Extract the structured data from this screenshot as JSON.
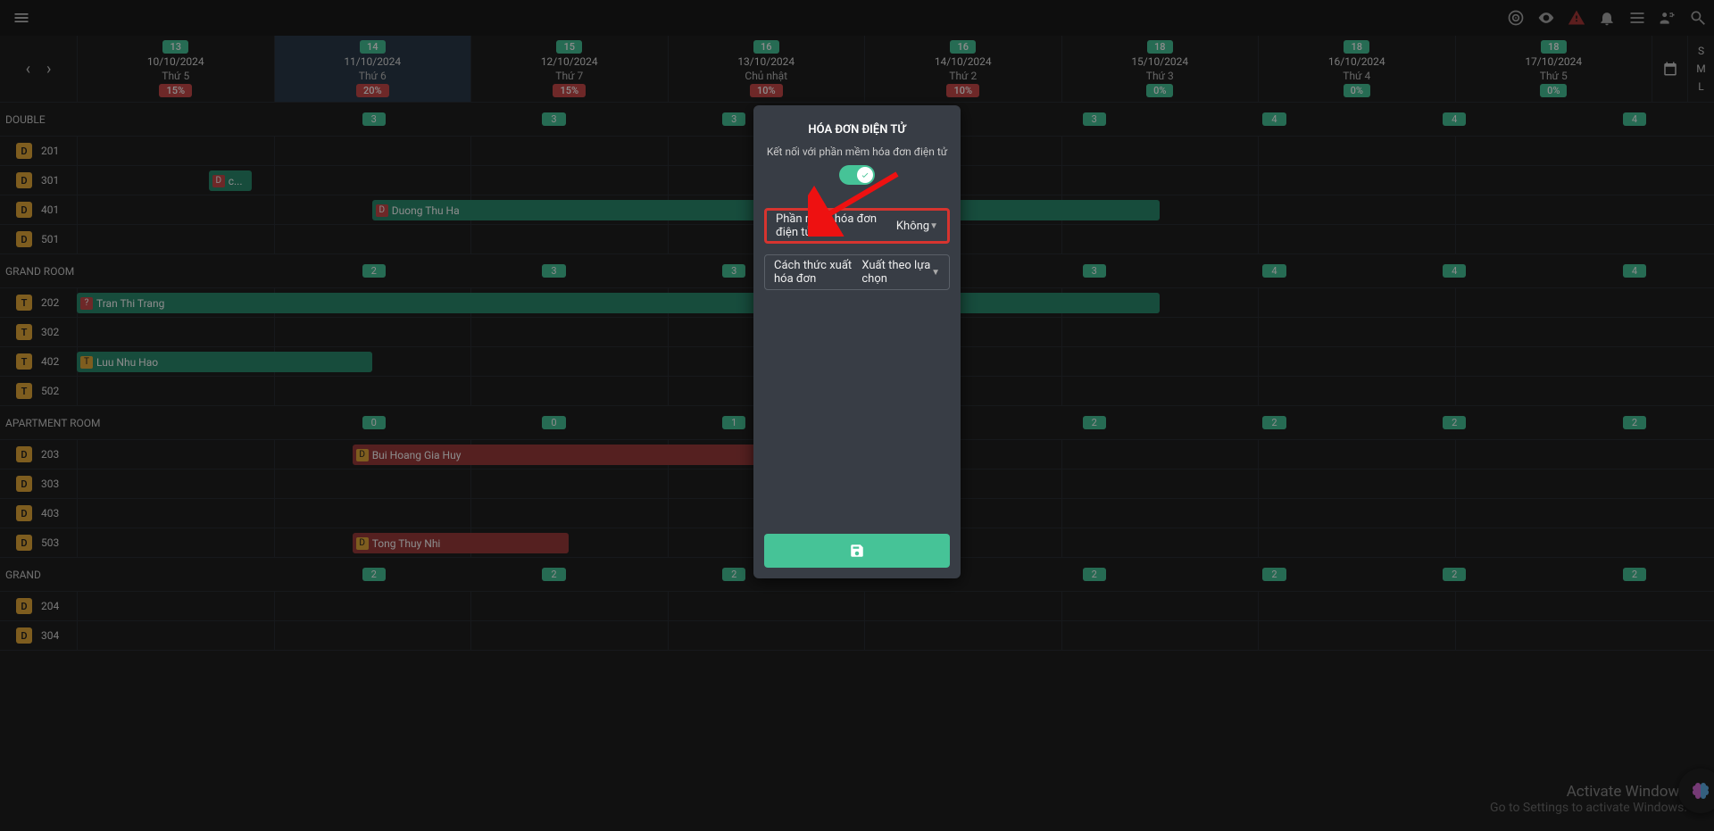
{
  "colors": {
    "teal": "#46c397",
    "red": "#c94a4a",
    "amber": "#e6a93a"
  },
  "sizes": [
    "S",
    "M",
    "L"
  ],
  "days": [
    {
      "badge": "13",
      "date": "10/10/2024",
      "dow": "Thứ 5",
      "pct": "15%",
      "pctClass": "red",
      "selected": false
    },
    {
      "badge": "14",
      "date": "11/10/2024",
      "dow": "Thứ 6",
      "pct": "20%",
      "pctClass": "red",
      "selected": true
    },
    {
      "badge": "15",
      "date": "12/10/2024",
      "dow": "Thứ 7",
      "pct": "15%",
      "pctClass": "red",
      "selected": false
    },
    {
      "badge": "16",
      "date": "13/10/2024",
      "dow": "Chủ nhật",
      "pct": "10%",
      "pctClass": "red",
      "selected": false
    },
    {
      "badge": "16",
      "date": "14/10/2024",
      "dow": "Thứ 2",
      "pct": "10%",
      "pctClass": "red",
      "selected": false
    },
    {
      "badge": "18",
      "date": "15/10/2024",
      "dow": "Thứ 3",
      "pct": "0%",
      "pctClass": "teal",
      "selected": false
    },
    {
      "badge": "18",
      "date": "16/10/2024",
      "dow": "Thứ 4",
      "pct": "0%",
      "pctClass": "teal",
      "selected": false
    },
    {
      "badge": "18",
      "date": "17/10/2024",
      "dow": "Thứ 5",
      "pct": "0%",
      "pctClass": "teal",
      "selected": false
    }
  ],
  "sections": [
    {
      "name": "DOUBLE",
      "counts": [
        "3",
        "3",
        "3",
        "",
        "3",
        "4",
        "4",
        "4"
      ],
      "rooms": [
        {
          "tag": "D",
          "num": "201",
          "bookings": []
        },
        {
          "tag": "D",
          "num": "301",
          "bookings": [
            {
              "start": 0.67,
              "span": 0.22,
              "color": "teal",
              "tag": "D",
              "tagClass": "red",
              "label": "c..."
            }
          ]
        },
        {
          "tag": "D",
          "num": "401",
          "bookings": [
            {
              "start": 1.5,
              "span": 4.0,
              "color": "teal",
              "tag": "D",
              "tagClass": "red",
              "label": "Duong Thu Ha"
            }
          ]
        },
        {
          "tag": "D",
          "num": "501",
          "bookings": []
        }
      ]
    },
    {
      "name": "GRAND ROOM",
      "counts": [
        "2",
        "3",
        "3",
        "",
        "3",
        "4",
        "4",
        "4"
      ],
      "rooms": [
        {
          "tag": "T",
          "num": "202",
          "bookings": [
            {
              "start": 0.0,
              "span": 5.5,
              "color": "teal",
              "tag": "?",
              "tagClass": "red",
              "label": "Tran Thi Trang"
            }
          ]
        },
        {
          "tag": "T",
          "num": "302",
          "bookings": []
        },
        {
          "tag": "T",
          "num": "402",
          "bookings": [
            {
              "start": 0.0,
              "span": 1.5,
              "color": "teal",
              "tag": "T",
              "tagClass": "amber",
              "label": "Luu Nhu Hao"
            }
          ]
        },
        {
          "tag": "T",
          "num": "502",
          "bookings": []
        }
      ]
    },
    {
      "name": "APARTMENT ROOM",
      "counts": [
        "0",
        "0",
        "1",
        "",
        "2",
        "2",
        "2",
        "2"
      ],
      "rooms": [
        {
          "tag": "D",
          "num": "203",
          "bookings": [
            {
              "start": 1.4,
              "span": 2.1,
              "color": "red",
              "tag": "D",
              "tagClass": "amber",
              "label": "Bui Hoang Gia Huy"
            }
          ]
        },
        {
          "tag": "D",
          "num": "303",
          "bookings": []
        },
        {
          "tag": "D",
          "num": "403",
          "bookings": []
        },
        {
          "tag": "D",
          "num": "503",
          "bookings": [
            {
              "start": 1.4,
              "span": 1.1,
              "color": "red",
              "tag": "D",
              "tagClass": "amber",
              "label": "Tong Thuy Nhi"
            }
          ]
        }
      ]
    },
    {
      "name": "GRAND",
      "counts": [
        "2",
        "2",
        "2",
        "",
        "2",
        "2",
        "2",
        "2"
      ],
      "rooms": [
        {
          "tag": "D",
          "num": "204",
          "bookings": []
        },
        {
          "tag": "D",
          "num": "304",
          "bookings": []
        }
      ]
    }
  ],
  "modal": {
    "title": "HÓA ĐƠN ĐIỆN TỬ",
    "subtitle": "Kết nối với phần mềm hóa đơn điện tử",
    "field1_label": "Phần mềm hóa đơn điện tử",
    "field1_value": "Không",
    "field2_label": "Cách thức xuất hóa đơn",
    "field2_value": "Xuất theo lựa chọn"
  },
  "watermark": {
    "l1": "Activate Windows",
    "l2": "Go to Settings to activate Windows."
  }
}
